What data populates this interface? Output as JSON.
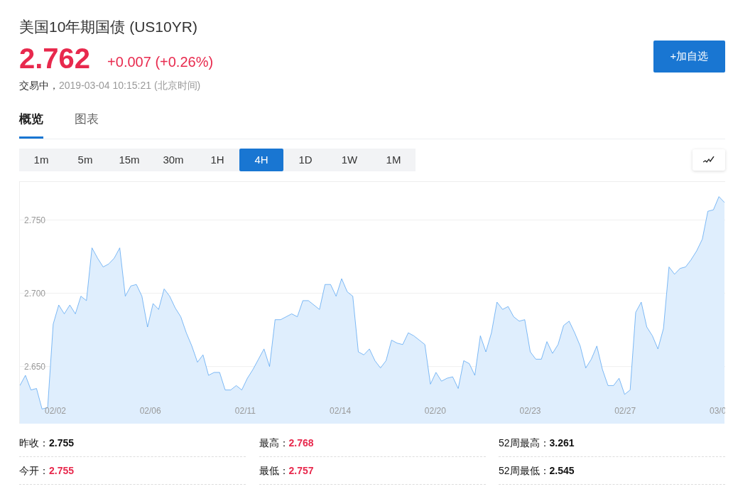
{
  "title": "美国10年期国债",
  "symbol": "(US10YR)",
  "quote": {
    "price": "2.762",
    "change": "+0.007 (+0.26%)",
    "status": "交易中，",
    "time": "2019-03-04 10:15:21",
    "timezone": "(北京时间)"
  },
  "watch_button": "+加自选",
  "tabs": [
    {
      "label": "概览",
      "selected": true
    },
    {
      "label": "图表",
      "selected": false
    }
  ],
  "ranges": [
    {
      "label": "1m",
      "selected": false
    },
    {
      "label": "5m",
      "selected": false
    },
    {
      "label": "15m",
      "selected": false
    },
    {
      "label": "30m",
      "selected": false
    },
    {
      "label": "1H",
      "selected": false
    },
    {
      "label": "4H",
      "selected": true
    },
    {
      "label": "1D",
      "selected": false
    },
    {
      "label": "1W",
      "selected": false
    },
    {
      "label": "1M",
      "selected": false
    }
  ],
  "chart_data": {
    "type": "area",
    "grid": true,
    "ylim": [
      2.611,
      2.776
    ],
    "yticks": [
      {
        "value": 2.65,
        "label": "2.650"
      },
      {
        "value": 2.7,
        "label": "2.700"
      },
      {
        "value": 2.75,
        "label": "2.750"
      }
    ],
    "series": [
      {
        "color": "#4a9df0",
        "values": [
          2.637,
          2.644,
          2.634,
          2.635,
          2.621,
          2.622,
          2.679,
          2.692,
          2.686,
          2.692,
          2.686,
          2.698,
          2.695,
          2.731,
          2.724,
          2.718,
          2.72,
          2.724,
          2.731,
          2.698,
          2.705,
          2.706,
          2.698,
          2.677,
          2.693,
          2.689,
          2.703,
          2.698,
          2.69,
          2.684,
          2.673,
          2.664,
          2.653,
          2.658,
          2.644,
          2.646,
          2.646,
          2.634,
          2.634,
          2.637,
          2.634,
          2.642,
          2.648,
          2.655,
          2.662,
          2.65,
          2.682,
          2.682,
          2.684,
          2.686,
          2.684,
          2.695,
          2.695,
          2.692,
          2.689,
          2.706,
          2.706,
          2.698,
          2.71,
          2.701,
          2.698,
          2.66,
          2.658,
          2.662,
          2.654,
          2.649,
          2.654,
          2.668,
          2.666,
          2.665,
          2.673,
          2.671,
          2.668,
          2.665,
          2.638,
          2.646,
          2.64,
          2.642,
          2.643,
          2.635,
          2.654,
          2.652,
          2.644,
          2.671,
          2.66,
          2.673,
          2.694,
          2.689,
          2.691,
          2.684,
          2.681,
          2.682,
          2.66,
          2.655,
          2.655,
          2.667,
          2.659,
          2.665,
          2.678,
          2.681,
          2.673,
          2.664,
          2.649,
          2.655,
          2.664,
          2.648,
          2.637,
          2.637,
          2.642,
          2.631,
          2.634,
          2.687,
          2.694,
          2.677,
          2.671,
          2.662,
          2.676,
          2.718,
          2.713,
          2.717,
          2.718,
          2.723,
          2.729,
          2.737,
          2.756,
          2.757,
          2.766,
          2.762
        ]
      }
    ]
  },
  "x_labels": [
    "02/02",
    "02/06",
    "02/11",
    "02/14",
    "02/20",
    "02/23",
    "02/27",
    "03/0"
  ],
  "stats": [
    [
      {
        "label": "昨收：",
        "value": "2.755",
        "color": "#111111"
      },
      {
        "label": "今开：",
        "value": "2.755",
        "color": "#e8294d"
      }
    ],
    [
      {
        "label": "最高：",
        "value": "2.768",
        "color": "#e8294d"
      },
      {
        "label": "最低：",
        "value": "2.757",
        "color": "#e8294d"
      }
    ],
    [
      {
        "label": "52周最高：",
        "value": "3.261",
        "color": "#111111"
      },
      {
        "label": "52周最低：",
        "value": "2.545",
        "color": "#111111"
      }
    ]
  ]
}
